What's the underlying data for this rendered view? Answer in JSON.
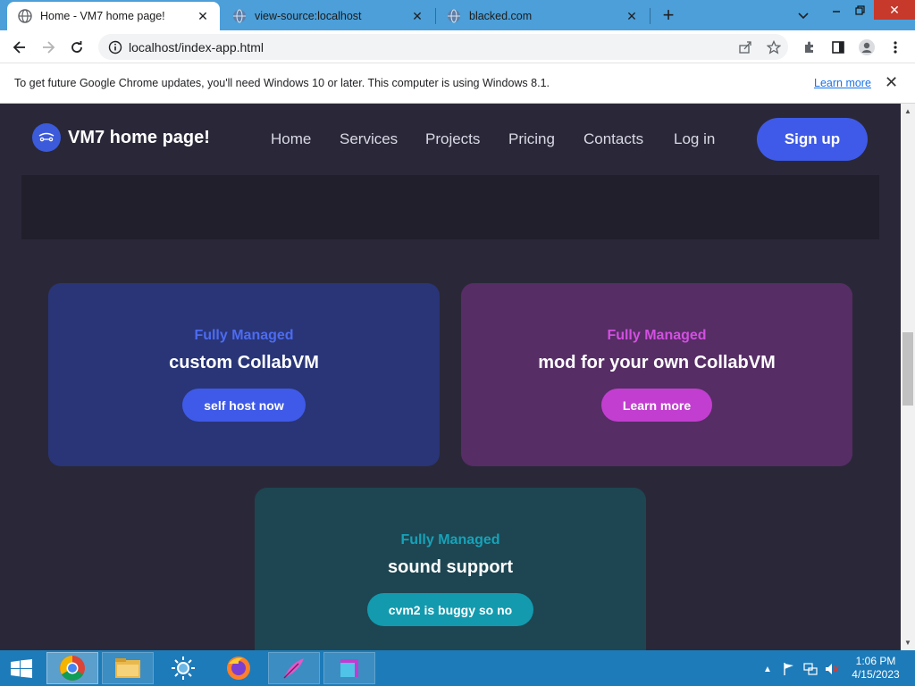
{
  "browser": {
    "tabs": [
      {
        "title": "Home - VM7 home page!",
        "favicon": "chrome-globe-icon",
        "active": true
      },
      {
        "title": "view-source:localhost",
        "favicon": "globe-icon",
        "active": false
      },
      {
        "title": "blacked.com",
        "favicon": "globe-icon",
        "active": false
      }
    ],
    "new_tab_label": "+",
    "url": "localhost/index-app.html",
    "infobar": {
      "message": "To get future Google Chrome updates, you'll need Windows 10 or later. This computer is using Windows 8.1.",
      "link": "Learn more"
    }
  },
  "site": {
    "brand": "VM7 home page!",
    "nav": [
      "Home",
      "Services",
      "Projects",
      "Pricing",
      "Contacts",
      "Log in"
    ],
    "signup": "Sign up",
    "cards": [
      {
        "kicker": "Fully Managed",
        "heading": "custom CollabVM",
        "cta": "self host now"
      },
      {
        "kicker": "Fully Managed",
        "heading": "mod for your own CollabVM",
        "cta": "Learn more"
      },
      {
        "kicker": "Fully Managed",
        "heading": "sound support",
        "cta": "cvm2 is buggy so no"
      }
    ]
  },
  "taskbar": {
    "apps": [
      "chrome-icon",
      "file-explorer-icon",
      "sun-app-icon",
      "firefox-icon",
      "feather-app-icon",
      "window-app-icon"
    ],
    "clock": {
      "time": "1:06 PM",
      "date": "4/15/2023"
    }
  },
  "colors": {
    "tab_strip": "#4c9fd8",
    "page_bg": "#2a2838",
    "primary": "#3f5ae8",
    "magenta": "#c23ed0",
    "teal": "#139aae",
    "taskbar": "#1d7bb9"
  }
}
